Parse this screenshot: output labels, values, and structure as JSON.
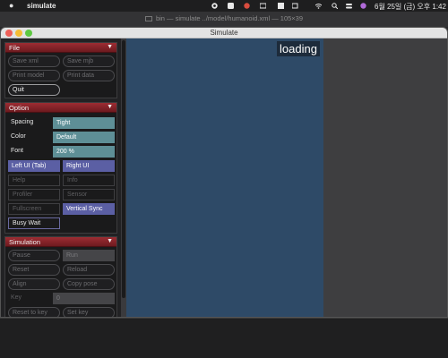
{
  "menubar": {
    "app_name": "simulate",
    "status_text": "6월 25일 (금) 오후 1:42"
  },
  "background_window": {
    "title": "bin — simulate ../model/humanoid.xml — 105×39"
  },
  "window": {
    "title": "Simulate"
  },
  "file_panel": {
    "title": "File",
    "buttons": [
      "Save xml",
      "Save mjb",
      "Print model",
      "Print data",
      "Quit"
    ]
  },
  "option_panel": {
    "title": "Option",
    "rows": [
      {
        "label": "Spacing",
        "value": "Tight"
      },
      {
        "label": "Color",
        "value": "Default"
      },
      {
        "label": "Font",
        "value": "200 %"
      }
    ],
    "toggles": [
      "Left UI (Tab)",
      "Right UI",
      "Help",
      "Info",
      "Profiler",
      "Sensor",
      "Fullscreen",
      "Vertical Sync",
      "Busy Wait"
    ]
  },
  "simulation_panel": {
    "title": "Simulation",
    "buttons": [
      "Pause",
      "Run",
      "Reset",
      "Reload",
      "Align",
      "Copy pose",
      "Key",
      "0",
      "Reset to key",
      "Set key"
    ]
  },
  "viewport": {
    "status": "loading"
  },
  "colors": {
    "panel_header": "#8a2329",
    "teal": "#5e8f96",
    "purple": "#5b5fa4",
    "viewport": "#2e4a67"
  }
}
